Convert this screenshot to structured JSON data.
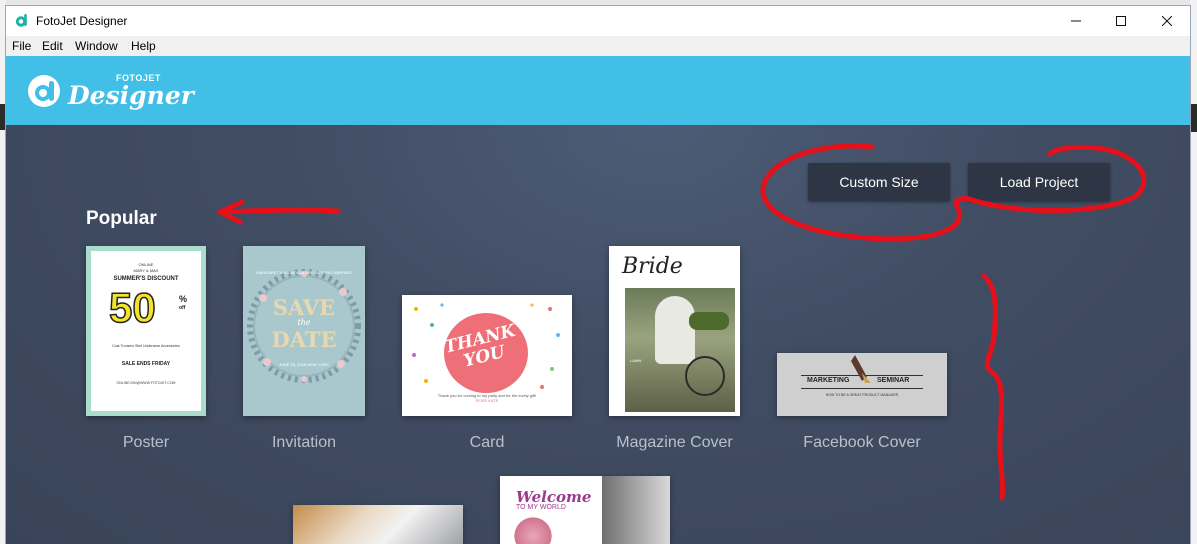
{
  "window": {
    "title": "FotoJet Designer",
    "controls": {
      "minimize": "minimize-icon",
      "maximize": "maximize-icon",
      "close": "close-icon"
    }
  },
  "menu": {
    "items": [
      "File",
      "Edit",
      "Window",
      "Help"
    ]
  },
  "header": {
    "logo_small": "FOTOJET",
    "logo_main": "Designer",
    "background": "#41bfe6"
  },
  "main": {
    "section_title": "Popular",
    "buttons": {
      "custom_size": "Custom Size",
      "load_project": "Load Project"
    },
    "templates": [
      {
        "label": "Poster"
      },
      {
        "label": "Invitation"
      },
      {
        "label": "Card"
      },
      {
        "label": "Magazine Cover"
      },
      {
        "label": "Facebook Cover"
      }
    ]
  },
  "thumbnails": {
    "poster": {
      "online": "ONLINE",
      "names": "MARY & MAX",
      "discount": "SUMMER'S DISCOUNT",
      "big": "50",
      "percent": "%",
      "off": "off",
      "categories": "Coat  Trousers  Skirt  Underwear  Accessories",
      "sale": "SALE ENDS FRIDAY",
      "footer": "ONLINE.DIN@WWW.FOTOJET.COM"
    },
    "invitation": {
      "top": "MARGARET & NICHOLAS ARE GETTING MARRIED",
      "save": "SAVE",
      "the": "the",
      "date": "DATE",
      "bottom": "JUNE 23, 2016 NEW YORK"
    },
    "card": {
      "line1": "THANK",
      "line2": "YOU",
      "note": "Thank you for coming to my party and for the lovely gift!",
      "sign": "ROSS KATE"
    },
    "magazine": {
      "title": "Bride",
      "side1": "LAWN"
    },
    "facebook": {
      "left": "MARKETING",
      "right": "SEMINAR",
      "sub": "HOW TO BE A GREAT PRODUCT MANAGER"
    },
    "lower": {
      "welcome": "Welcome",
      "sub": "TO MY WORLD"
    }
  },
  "colors": {
    "annotation": "#e5101a",
    "button_bg": "#2e3646",
    "label": "#b9c0cc"
  }
}
